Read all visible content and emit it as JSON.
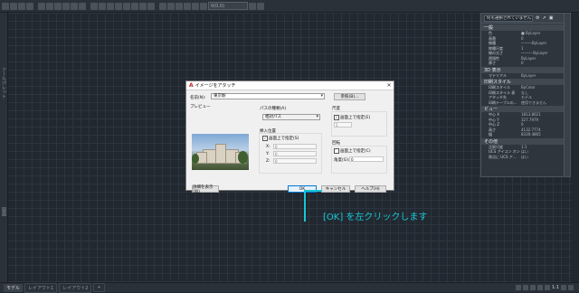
{
  "toolbar": {
    "layer_value": "0(0,0)"
  },
  "left_palette": {
    "label_top": "ツールパレット",
    "label_bottom": "図面"
  },
  "properties": {
    "selector": "何も選択されていません",
    "sections": [
      {
        "title": "一般",
        "rows": [
          {
            "k": "色",
            "v": "■ ByLayer"
          },
          {
            "k": "画層",
            "v": "0"
          },
          {
            "k": "線種",
            "v": "―――ByLayer"
          },
          {
            "k": "線種尺度",
            "v": "1"
          },
          {
            "k": "線の太さ",
            "v": "――― ByLayer"
          },
          {
            "k": "透過性",
            "v": "ByLayer"
          },
          {
            "k": "厚さ",
            "v": "0"
          }
        ]
      },
      {
        "title": "3D 表示",
        "rows": [
          {
            "k": "マテリアル",
            "v": "ByLayer"
          }
        ]
      },
      {
        "title": "印刷スタイル",
        "rows": [
          {
            "k": "印刷スタイル",
            "v": "ByColor"
          },
          {
            "k": "印刷スタイル 表",
            "v": "なし"
          },
          {
            "k": "アタッチ先",
            "v": "モデル"
          },
          {
            "k": "印刷テーブルの...",
            "v": "使用できません"
          }
        ]
      },
      {
        "title": "ビュー",
        "rows": [
          {
            "k": "中心 X",
            "v": "1813.8021"
          },
          {
            "k": "中心 Y",
            "v": "327.7979"
          },
          {
            "k": "中心 Z",
            "v": "0"
          },
          {
            "k": "高さ",
            "v": "4132.7774"
          },
          {
            "k": "幅",
            "v": "8339.4865"
          }
        ]
      },
      {
        "title": "その他",
        "rows": [
          {
            "k": "注釈尺度",
            "v": "1:1"
          },
          {
            "k": "UCS アイコン オン",
            "v": "はい"
          },
          {
            "k": "原点に UCS ア...",
            "v": "はい"
          }
        ]
      }
    ]
  },
  "dialog": {
    "title": "イメージをアタッチ",
    "name_label": "名前(N):",
    "name_value": "東京駅",
    "browse_button": "参照(B)...",
    "preview_label": "プレビュー",
    "path_type_label": "パスの種類(A)",
    "path_type_value": "相対パス",
    "insertion_label": "挿入位置",
    "insertion_onscreen": "画面上で指定(S)",
    "x_label": "X:",
    "x_value": "0",
    "y_label": "Y:",
    "y_value": "0",
    "z_label": "Z:",
    "z_value": "0",
    "scale_label": "尺度",
    "scale_onscreen": "画面上で指定(E)",
    "scale_value": "1",
    "rotation_label": "回転",
    "rotation_onscreen": "画面上で指定(C)",
    "angle_label": "角度(G):",
    "angle_value": "0",
    "details_button": "詳細を表示(W)",
    "ok_button": "OK",
    "cancel_button": "キャンセル",
    "help_button": "ヘルプ(H)"
  },
  "status": {
    "tabs": [
      "モデル",
      "レイアウト1",
      "レイアウト2"
    ],
    "scale": "1:1"
  },
  "annotation": {
    "text": "[OK] を左クリックします",
    "color": "#19c6d4"
  }
}
